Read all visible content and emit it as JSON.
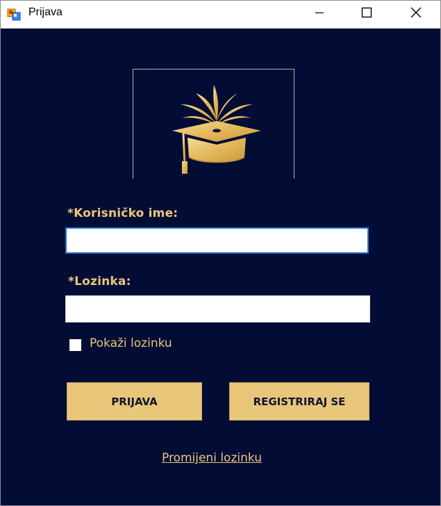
{
  "window": {
    "title": "Prijava",
    "app_icon": "windows-form-icon",
    "controls": [
      "minimize-icon",
      "maximize-icon",
      "close-icon"
    ]
  },
  "logo": {
    "icon": "graduation-cap-icon"
  },
  "form": {
    "username_label": "*Korisničko ime:",
    "username_value": "",
    "password_label": "*Lozinka:",
    "password_value": "",
    "show_password_label": "Pokaži lozinku",
    "show_password_checked": false
  },
  "buttons": {
    "login_label": "PRIJAVA",
    "register_label": "REGISTRIRAJ SE"
  },
  "links": {
    "change_password": "Promijeni lozinku"
  },
  "colors": {
    "background": "#030c35",
    "accent_gold": "#e8c77a",
    "input_focus_border": "#1f74d0"
  }
}
